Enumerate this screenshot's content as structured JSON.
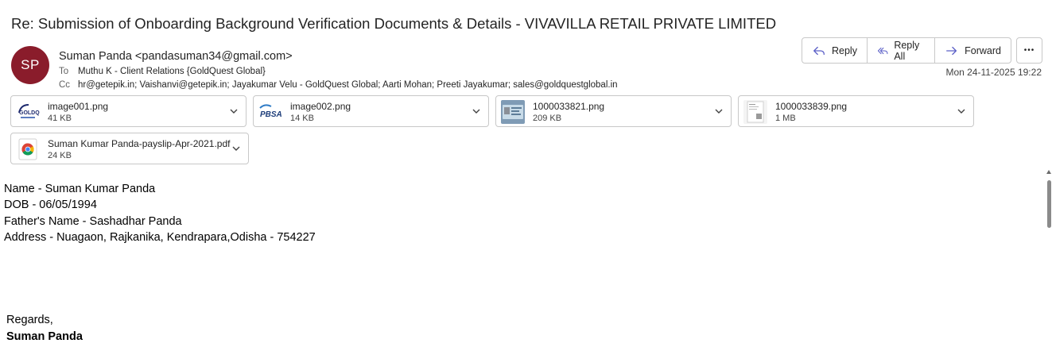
{
  "email": {
    "subject": "Re: Submission of Onboarding Background Verification Documents & Details - VIVAVILLA RETAIL PRIVATE LIMITED",
    "sender": {
      "initials": "SP",
      "avatar_color": "#8a1c2b",
      "display": "Suman Panda <pandasuman34@gmail.com>"
    },
    "to_label": "To",
    "to": "Muthu K - Client Relations {GoldQuest Global}",
    "cc_label": "Cc",
    "cc": "hr@getepik.in; Vaishanvi@getepik.in; Jayakumar Velu - GoldQuest Global; Aarti Mohan; Preeti Jayakumar; sales@goldquestglobal.in",
    "date": "Mon 24-11-2025 19:22"
  },
  "actions": {
    "reply": "Reply",
    "reply_all": "Reply All",
    "forward": "Forward",
    "more": "•••",
    "accent": "#5b5fc7"
  },
  "attachments": [
    {
      "name": "image001.png",
      "size": "41 KB",
      "icon": "goldquest-logo-thumbnail"
    },
    {
      "name": "image002.png",
      "size": "14 KB",
      "icon": "pbsa-logo-thumbnail"
    },
    {
      "name": "1000033821.png",
      "size": "209 KB",
      "icon": "id-card-photo-thumbnail"
    },
    {
      "name": "1000033839.png",
      "size": "1 MB",
      "icon": "document-photo-thumbnail"
    },
    {
      "name": "Suman Kumar Panda-payslip-Apr-2021.pdf",
      "size": "24 KB",
      "icon": "chrome-pdf-icon"
    }
  ],
  "message": {
    "lines": [
      "Name - Suman Kumar Panda",
      "DOB - 06/05/1994",
      "Father's Name - Sashadhar Panda",
      "Address - Nuagaon, Rajkanika, Kendrapara,Odisha - 754227"
    ],
    "closing": "Regards,",
    "signature": "Suman Panda"
  }
}
